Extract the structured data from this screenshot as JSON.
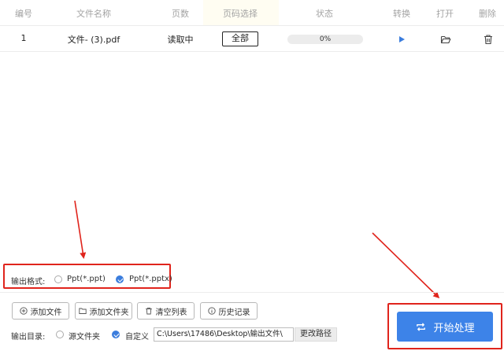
{
  "table": {
    "columns": [
      "编号",
      "文件名称",
      "页数",
      "页码选择",
      "状态",
      "转换",
      "打开",
      "删除"
    ],
    "rows": [
      {
        "index": "1",
        "filename": "文件- (3).pdf",
        "pages": "读取中",
        "page_select": "全部",
        "progress_label": "0%",
        "progress": 0
      }
    ]
  },
  "output_format": {
    "label": "输出格式:",
    "options": [
      {
        "label": "Ppt(*.ppt)",
        "selected": false
      },
      {
        "label": "Ppt(*.pptx)",
        "selected": true
      }
    ]
  },
  "toolbar": {
    "add_file": "添加文件",
    "add_folder": "添加文件夹",
    "clear_list": "清空列表",
    "history": "历史记录"
  },
  "output_dir": {
    "label": "输出目录:",
    "options": [
      {
        "label": "源文件夹",
        "selected": false
      },
      {
        "label": "自定义",
        "selected": true
      }
    ],
    "path": "C:\\Users\\17486\\Desktop\\输出文件\\",
    "change_label": "更改路径"
  },
  "start_button": {
    "label": "开始处理"
  },
  "colors": {
    "accent": "#3d83e8",
    "annotation_red": "#e0241c",
    "progress_fill": "#4a90e2"
  },
  "icons": {
    "convert": "play-icon",
    "open": "folder-open-icon",
    "delete": "trash-icon",
    "add_file": "plus-circle-icon",
    "add_folder": "folder-icon",
    "clear": "trash-icon",
    "history": "info-icon",
    "start": "repeat-icon"
  }
}
